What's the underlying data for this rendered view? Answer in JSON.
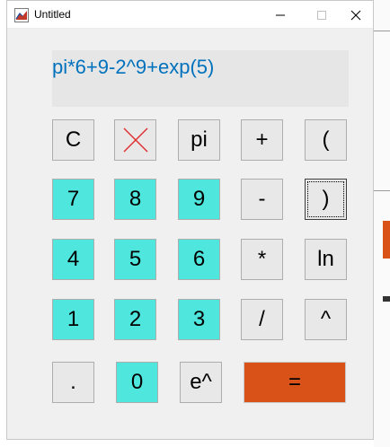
{
  "window": {
    "title": "Untitled",
    "controls": {
      "minimize": "minimize",
      "maximize": "maximize",
      "close": "close"
    }
  },
  "display": {
    "expression": "pi*6+9-2^9+exp(5)",
    "color": "#0072bd"
  },
  "keys": {
    "clear": "C",
    "backspace_icon": "x-icon",
    "pi": "pi",
    "plus": "+",
    "lparen": "(",
    "seven": "7",
    "eight": "8",
    "nine": "9",
    "minus": "-",
    "rparen": ")",
    "four": "4",
    "five": "5",
    "six": "6",
    "times": "*",
    "ln": "ln",
    "one": "1",
    "two": "2",
    "three": "3",
    "divide": "/",
    "power": "^",
    "dot": ".",
    "zero": "0",
    "exp": "e^",
    "equals": "="
  },
  "colors": {
    "digit_key": "#4fe6dd",
    "equals_key": "#d95319",
    "op_key": "#e8e8e8",
    "clear_x": "#e03030"
  }
}
